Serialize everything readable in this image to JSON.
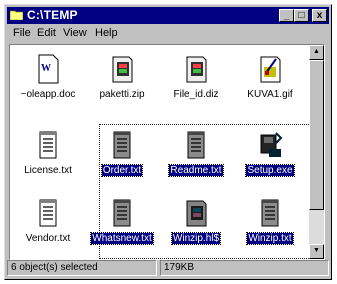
{
  "window": {
    "title": "C:\\TEMP",
    "buttons": {
      "minimize": "_",
      "maximize": "□",
      "close": "x"
    }
  },
  "menu": [
    "File",
    "Edit",
    "View",
    "Help"
  ],
  "icons": [
    {
      "label": "~oleapp.doc",
      "selected": false,
      "kind": "word-document-icon"
    },
    {
      "label": "paketti.zip",
      "selected": false,
      "kind": "zip-archive-icon"
    },
    {
      "label": "File_id.diz",
      "selected": false,
      "kind": "zip-archive-icon"
    },
    {
      "label": "KUVA1.gif",
      "selected": false,
      "kind": "paint-image-icon"
    },
    {
      "label": "License.txt",
      "selected": false,
      "kind": "text-file-icon"
    },
    {
      "label": "Order.txt",
      "selected": true,
      "kind": "text-file-icon"
    },
    {
      "label": "Readme.txt",
      "selected": true,
      "kind": "text-file-icon"
    },
    {
      "label": "Setup.exe",
      "selected": true,
      "kind": "setup-program-icon"
    },
    {
      "label": "Vendor.txt",
      "selected": false,
      "kind": "text-file-icon"
    },
    {
      "label": "Whatsnew.txt",
      "selected": true,
      "kind": "text-file-icon"
    },
    {
      "label": "Winzip.hl$",
      "selected": true,
      "kind": "zip-archive-icon"
    },
    {
      "label": "Winzip.txt",
      "selected": true,
      "kind": "text-file-icon"
    }
  ],
  "status": {
    "selection": "6 object(s) selected",
    "size": "179KB"
  },
  "colors": {
    "titlebar": "#000080",
    "face": "#c0c0c0",
    "selection": "#000080"
  }
}
